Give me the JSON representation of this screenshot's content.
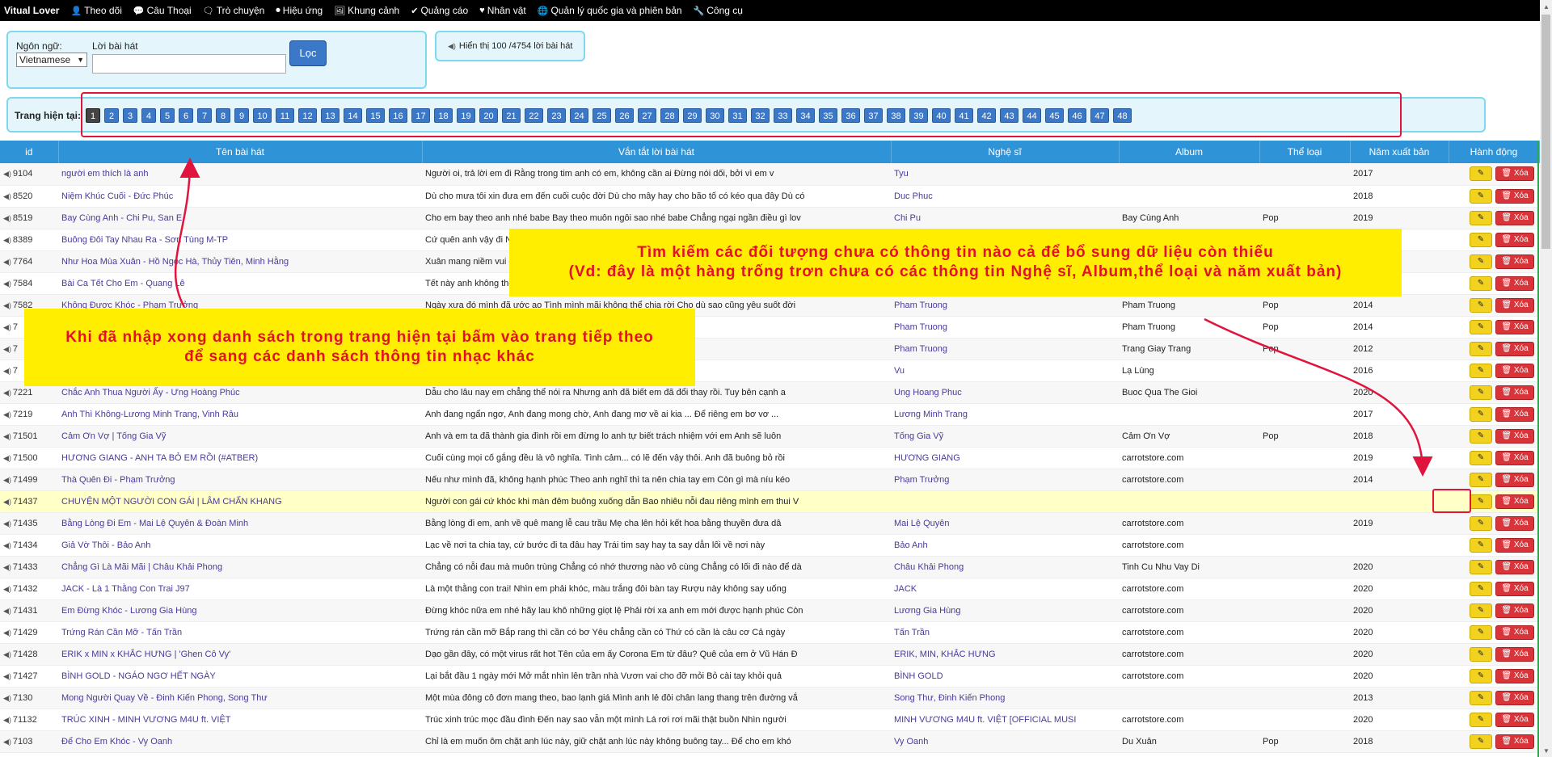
{
  "navbar": {
    "brand": "Vitual Lover",
    "items": [
      {
        "icon": "user-icon",
        "glyph": "👤",
        "label": "Theo dõi"
      },
      {
        "icon": "speech-bubble-icon",
        "glyph": "💬",
        "label": "Câu Thoại"
      },
      {
        "icon": "chat-icon",
        "glyph": "🗨",
        "label": "Trò chuyện"
      },
      {
        "icon": "play-circle-icon",
        "glyph": "⏺",
        "label": "Hiệu ứng"
      },
      {
        "icon": "image-icon",
        "glyph": "🖼",
        "label": "Khung cảnh"
      },
      {
        "icon": "check-circle-icon",
        "glyph": "✔",
        "label": "Quảng cáo"
      },
      {
        "icon": "heart-icon",
        "glyph": "♥",
        "label": "Nhân vật"
      },
      {
        "icon": "globe-icon",
        "glyph": "🌐",
        "label": "Quản lý quốc gia và phiên bản"
      },
      {
        "icon": "wrench-icon",
        "glyph": "🔧",
        "label": "Công cụ"
      }
    ]
  },
  "filter": {
    "language_label": "Ngôn ngữ:",
    "language_value": "Vietnamese",
    "lyric_label": "Lời bài hát",
    "lyric_value": "",
    "button": "Lọc"
  },
  "count_text": "Hiển thị 100 /4754 lời bài hát",
  "pagination": {
    "label": "Trang hiện tại:",
    "current": "1",
    "pages": [
      "1",
      "2",
      "3",
      "4",
      "5",
      "6",
      "7",
      "8",
      "9",
      "10",
      "11",
      "12",
      "13",
      "14",
      "15",
      "16",
      "17",
      "18",
      "19",
      "20",
      "21",
      "22",
      "23",
      "24",
      "25",
      "26",
      "27",
      "28",
      "29",
      "30",
      "31",
      "32",
      "33",
      "34",
      "35",
      "36",
      "37",
      "38",
      "39",
      "40",
      "41",
      "42",
      "43",
      "44",
      "45",
      "46",
      "47",
      "48"
    ]
  },
  "table": {
    "headers": [
      "id",
      "Tên bài hát",
      "Vắn tắt lời bài hát",
      "Nghệ sĩ",
      "Album",
      "Thể loại",
      "Năm xuất bản",
      "Hành động"
    ],
    "edit_label": "✎",
    "delete_label": "🗑 Xóa",
    "rows": [
      {
        "id": "9104",
        "title": "người em thích là anh",
        "lyric": "Người oi, trả lời em đi Rằng trong tim anh có em, không cần ai Đừng nói dối, bởi vì em v",
        "artist": "Tyu",
        "album": "",
        "genre": "",
        "year": "2017"
      },
      {
        "id": "8520",
        "title": "Niệm Khúc Cuối - Đức Phúc",
        "lyric": "Dù cho mưa tôi xin đưa em đến cuối cuộc đời Dù cho mây hay cho bão tố có kéo qua đây Dù có",
        "artist": "Duc Phuc",
        "album": "",
        "genre": "",
        "year": "2018"
      },
      {
        "id": "8519",
        "title": "Bay Cùng Anh - Chi Pu, San E",
        "lyric": "Cho em bay theo anh nhé babe Bay theo muôn ngôi sao nhé babe Chẳng ngại ngần điều gì lov",
        "artist": "Chi Pu",
        "album": "Bay Cùng Anh",
        "genre": "Pop",
        "year": "2019"
      },
      {
        "id": "8389",
        "title": "Buông Đôi Tay Nhau Ra - Sơn Tùng M-TP",
        "lyric": "Cứ quên anh vậy đi N",
        "artist": "",
        "album": "",
        "genre": "",
        "year": ""
      },
      {
        "id": "7764",
        "title": "Như Hoa Mùa Xuân - Hồ Ngọc Hà, Thủy Tiên, Minh Hằng",
        "lyric": "Xuân mang niềm vui c",
        "artist": "",
        "album": "",
        "genre": "",
        "year": ""
      },
      {
        "id": "7584",
        "title": "Bài Ca Tết Cho Em - Quang Lê",
        "lyric": "Tết này anh không thể",
        "artist": "",
        "album": "",
        "genre": "",
        "year": ""
      },
      {
        "id": "7582",
        "title": "Không Được Khóc - Phạm Trưởng",
        "lyric": "Ngày xưa đó mình đã ước ao Tình mình mãi không thể chia rời Cho dù sao cũng yêu suốt đời",
        "artist": "Pham Truong",
        "album": "Pham Truong",
        "genre": "Pop",
        "year": "2014"
      },
      {
        "id": "7",
        "title": "",
        "lyric": "ớc mất em rơi lệ thê bước c",
        "artist": "Pham Truong",
        "album": "Pham Truong",
        "genre": "Pop",
        "year": "2014"
      },
      {
        "id": "7",
        "title": "",
        "lyric": "a biết bao sóng gió N",
        "artist": "Pham Truong",
        "album": "Trang Giay Trang",
        "genre": "Pop",
        "year": "2012"
      },
      {
        "id": "7",
        "title": "",
        "lyric": "a thời gian Chiều lặng im",
        "artist": "Vu",
        "album": "Lạ Lùng",
        "genre": "",
        "year": "2016"
      },
      {
        "id": "7221",
        "title": "Chắc Anh Thua Người Ấy - Ưng Hoàng Phúc",
        "lyric": "Dẫu cho lâu nay em chẳng thể nói ra Nhưng anh đã biết em đã đổi thay rồi. Tuy bên cạnh a",
        "artist": "Ung Hoang Phuc",
        "album": "Buoc Qua The Gioi",
        "genre": "",
        "year": "2020"
      },
      {
        "id": "7219",
        "title": "Anh Thì Không-Lương Minh Trang, Vinh Râu",
        "lyric": "Anh đang ngẩn ngơ, Anh đang mong chờ, Anh đang mơ về ai kia ... Để riêng em bơ vơ ...",
        "artist": "Lương Minh Trang",
        "album": "",
        "genre": "",
        "year": "2017"
      },
      {
        "id": "71501",
        "title": "Cảm Ơn Vợ | Tống Gia Vỹ",
        "lyric": "Anh và em ta đã thành gia đình rồi em đừng lo anh tự biết trách nhiệm với em Anh sẽ luôn",
        "artist": "Tống Gia Vỹ",
        "album": "Cảm Ơn Vợ",
        "genre": "Pop",
        "year": "2018"
      },
      {
        "id": "71500",
        "title": "HƯƠNG GIANG - ANH TA BỎ EM RỒI (#ATBER)",
        "lyric": "Cuối cùng mọi cố gắng đều là vô nghĩa. Tình cảm... có lẽ đến vậy thôi. Anh đã buông bỏ rồi",
        "artist": "HƯƠNG GIANG",
        "album": "carrotstore.com",
        "genre": "",
        "year": "2019"
      },
      {
        "id": "71499",
        "title": "Thà Quên Đi - Phạm Trưởng",
        "lyric": "Nếu như mình đã, không hạnh phúc Theo anh nghĩ thì ta nên chia tay em Còn gì mà níu kéo",
        "artist": "Phạm Trưởng",
        "album": "carrotstore.com",
        "genre": "",
        "year": "2014"
      },
      {
        "id": "71437",
        "title": "CHUYỆN MỘT NGƯỜI CON GÁI | LÂM CHẤN KHANG",
        "lyric": "Người con gái cứ khóc khi màn đêm buông xuống dẫn Bao nhiêu nỗi đau riêng mình em thui V",
        "artist": "",
        "album": "",
        "genre": "",
        "year": "",
        "highlight": true
      },
      {
        "id": "71435",
        "title": "Bằng Lòng Đi Em - Mai Lệ Quyên & Đoàn Minh",
        "lyric": "Bằng lòng đi em, anh về quê mang lễ cau trầu Mẹ cha lên hỏi kết hoa bằng thuyền đưa dâ",
        "artist": "Mai Lệ Quyên",
        "album": "carrotstore.com",
        "genre": "",
        "year": "2019"
      },
      {
        "id": "71434",
        "title": "Giả Vờ Thôi - Bảo Anh",
        "lyric": "Lạc về nơi ta chia tay, cứ bước đi ta đâu hay Trái tim say hay ta say dẫn lối về nơi này",
        "artist": "Bảo Anh",
        "album": "carrotstore.com",
        "genre": "",
        "year": ""
      },
      {
        "id": "71433",
        "title": "Chẳng Gì Là Mãi Mãi | Châu Khải Phong",
        "lyric": "Chẳng có nỗi đau mà muôn trùng Chẳng có nhớ thương nào vô cùng Chẳng có lối đi nào để dà",
        "artist": "Châu Khải Phong",
        "album": "Tinh Cu Nhu Vay Di",
        "genre": "",
        "year": "2020"
      },
      {
        "id": "71432",
        "title": "JACK - Là 1 Thằng Con Trai J97",
        "lyric": "Là một thằng con trai! Nhìn em phải khóc, màu trắng đôi bàn tay Rượu này không say uống",
        "artist": "JACK",
        "album": "carrotstore.com",
        "genre": "",
        "year": "2020"
      },
      {
        "id": "71431",
        "title": "Em Đừng Khóc - Lương Gia Hùng",
        "lyric": "Đừng khóc nữa em nhé hãy lau khô những giọt lệ Phải rời xa anh em mới được hạnh phúc Còn",
        "artist": "Lương Gia Hùng",
        "album": "carrotstore.com",
        "genre": "",
        "year": "2020"
      },
      {
        "id": "71429",
        "title": "Trứng Rán Cần Mỡ - Tấn Trần",
        "lyric": "Trứng rán cần mỡ Bắp rang thì cần có bơ Yêu chẳng cần có Thứ có cần là câu cơ Cả ngày",
        "artist": "Tấn Trần",
        "album": "carrotstore.com",
        "genre": "",
        "year": "2020"
      },
      {
        "id": "71428",
        "title": "ERIK x MIN x KHẮC HƯNG | 'Ghen Cô Vy'",
        "lyric": "Dạo gần đây, có một virus rất hot Tên của em ấy Corona Em từ đâu? Quê của em ở Vũ Hán Đ",
        "artist": "ERIK, MIN, KHẮC HƯNG",
        "album": "carrotstore.com",
        "genre": "",
        "year": "2020"
      },
      {
        "id": "71427",
        "title": "BÌNH GOLD - NGÁO NGƠ HẾT NGÀY",
        "lyric": "Lại bắt đầu 1 ngày mới Mở mắt nhìn lên trần nhà Vươn vai cho đỡ mỏi Bỏ cài tay khỏi quả",
        "artist": "BÌNH GOLD",
        "album": "carrotstore.com",
        "genre": "",
        "year": "2020"
      },
      {
        "id": "7130",
        "title": "Mong Người Quay Về - Đinh Kiến Phong, Song Thư",
        "lyric": "Một mùa đông cô đơn mang theo, bao lạnh giá Mình anh lẻ đôi chân lang thang trên đường vắ",
        "artist": "Song Thư, Đinh Kiến Phong",
        "album": "",
        "genre": "",
        "year": "2013"
      },
      {
        "id": "71132",
        "title": "TRÚC XINH - MINH VƯƠNG M4U ft. VIỆT",
        "lyric": "Trúc xinh trúc mọc đầu đình Đến nay sao vẫn một mình Lá rơi rơi mãi thật buồn Nhìn người",
        "artist": "MINH VƯƠNG M4U ft. VIỆT [OFFICIAL MUSI",
        "album": "carrotstore.com",
        "genre": "",
        "year": "2020"
      },
      {
        "id": "7103",
        "title": "Để Cho Em Khóc - Vy Oanh",
        "lyric": "Chỉ là em muốn ôm chặt anh lúc này, giữ chặt anh lúc này không buông tay... Để cho em khó",
        "artist": "Vy Oanh",
        "album": "Du Xuân",
        "genre": "Pop",
        "year": "2018"
      }
    ]
  },
  "annotations": {
    "missing_info_note": [
      "Tìm kiếm các đối tượng chưa có thông tin nào cả để bổ sung dữ liệu còn thiếu",
      "(Vd: đây là một hàng trống trơn chưa có các thông tin Nghệ sĩ, Album,thể loại và năm xuất bản)"
    ],
    "next_page_note": [
      "Khi đã nhập xong danh sách trong trang hiện tại bấm vào trang tiếp theo",
      "để sang các danh sách thông tin nhạc khác"
    ],
    "highlight_color": "#e0143c",
    "note_bg": "#ffee00"
  }
}
